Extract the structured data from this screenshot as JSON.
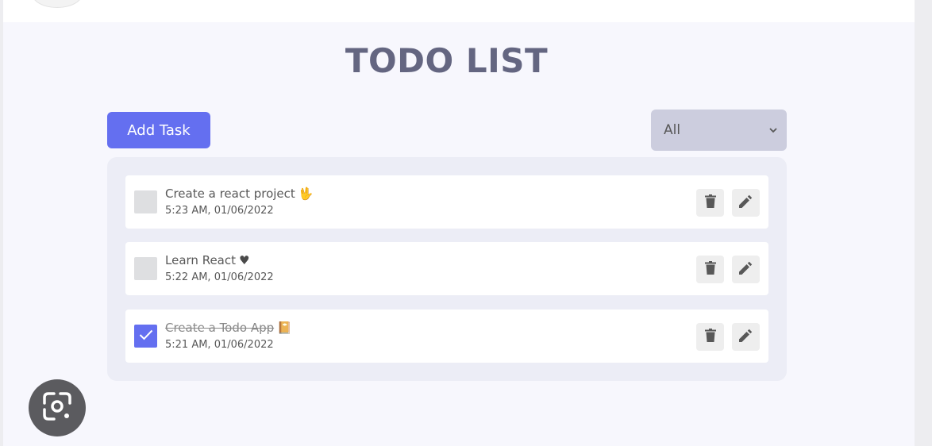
{
  "app": {
    "title": "TODO LIST"
  },
  "toolbar": {
    "add_label": "Add Task",
    "filter_selected": "All"
  },
  "tasks": [
    {
      "title": "Create a react project",
      "emoji": "🖖",
      "time": "5:23 AM, 01/06/2022",
      "completed": false
    },
    {
      "title": "Learn React",
      "emoji": "♥",
      "time": "5:22 AM, 01/06/2022",
      "completed": false
    },
    {
      "title": "Create a Todo App",
      "emoji": "📔",
      "time": "5:21 AM, 01/06/2022",
      "completed": true
    }
  ],
  "icons": {
    "delete": "trash-icon",
    "edit": "pencil-icon",
    "check": "checkmark-icon",
    "lens": "google-lens-icon"
  },
  "colors": {
    "accent": "#646ff0",
    "title": "#646681",
    "filter_bg": "#cccdde",
    "panel_bg": "#ecedf6",
    "page_bg": "#f7f7fd"
  }
}
